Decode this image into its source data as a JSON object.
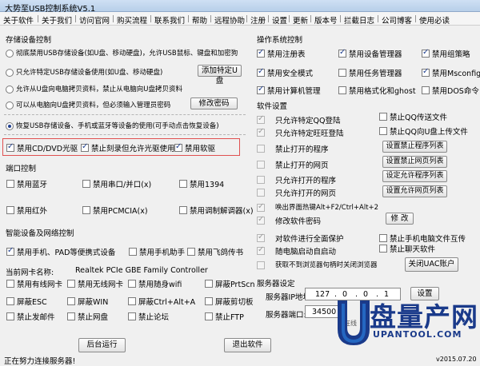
{
  "window": {
    "title": "大势至USB控制系统V5.1"
  },
  "menu": [
    "关于软件",
    "关于我们",
    "访问官网",
    "购买流程",
    "联系我们",
    "帮助",
    "远程协助",
    "注册",
    "设置",
    "更新",
    "版本号",
    "拦截日志",
    "公司博客",
    "使用必读"
  ],
  "storage": {
    "heading": "存储设备控制",
    "options": [
      "彻底禁用USB存储设备(如U盘、移动硬盘)，允许USB鼠标、键盘和加密狗",
      "只允许特定USB存储设备使用(如U盘、移动硬盘)",
      "允许从U盘向电脑拷贝资料，禁止从电脑向U盘拷贝资料",
      "可以从电脑向U盘拷贝资料，但必须输入管理员密码",
      "恢复USB存储设备、手机或蓝牙等设备的使用(可手动点击恢复设备)"
    ],
    "add_usb_button": "添加特定U盘",
    "change_pwd_button": "修改密码"
  },
  "cd": {
    "items": [
      "禁用CD/DVD光驱",
      "禁止刻录但允许光驱使用",
      "禁用软驱"
    ]
  },
  "port": {
    "heading": "端口控制",
    "items": [
      "禁用蓝牙",
      "禁用串口/并口(x)",
      "禁用1394",
      "禁用红外",
      "禁用PCMCIA(x)",
      "禁用调制解调器(x)"
    ]
  },
  "smart": {
    "heading": "智能设备及网络控制",
    "items": [
      "禁用手机、PAD等便携式设备",
      "禁用手机助手",
      "禁用飞鸽传书"
    ]
  },
  "nic": {
    "label": "当前网卡名称:",
    "name": "Realtek PCIe GBE Family Controller",
    "items": [
      "禁用有线网卡",
      "禁用无线网卡",
      "禁用随身wifi",
      "屏蔽PrtScn",
      "屏蔽ESC",
      "屏蔽WIN",
      "屏蔽Ctrl+Alt+A",
      "屏蔽剪切板",
      "禁止发邮件",
      "禁止网盘",
      "禁止论坛",
      "禁止FTP"
    ]
  },
  "os": {
    "heading": "操作系统控制",
    "items": [
      "禁用注册表",
      "禁用设备管理器",
      "禁用组策略",
      "禁用安全模式",
      "禁用任务管理器",
      "禁用Msconfig",
      "禁用计算机管理",
      "禁用格式化和ghost",
      "禁用DOS命令"
    ]
  },
  "software": {
    "heading": "软件设置",
    "items": [
      "只允许特定QQ登陆",
      "禁止QQ传送文件",
      "只允许特定旺旺登陆",
      "禁止QQ向U盘上传文件",
      "禁止打开的程序",
      "禁止打开的网页",
      "只允许打开的程序",
      "只允许打开的网页",
      "唤出界面热键Alt+F2/Ctrl+Alt+2",
      "修改软件密码",
      "对软件进行全面保护",
      "禁止手机电脑文件互传",
      "随电脑启动自启动",
      "禁止聊天软件",
      "获取不到浏览器句柄时关闭浏览器"
    ],
    "buttons": [
      "设置禁止程序列表",
      "设置禁止网页列表",
      "设定允许程序列表",
      "设置允许网页列表"
    ],
    "modify_button": "修 改",
    "uac_button": "关闭UAC账户"
  },
  "server": {
    "heading": "服务器设定",
    "ip_label": "服务器IP地址:",
    "ip": [
      "127",
      "0",
      "0",
      "1"
    ],
    "port_label": "服务器端口:",
    "port": "34500",
    "set_button": "设置",
    "partial": "在线"
  },
  "buttons": {
    "run_background": "后台运行",
    "exit": "退出软件"
  },
  "status": "正在努力连接服务器!",
  "version": "v2015.07.20",
  "watermark": {
    "brand": "盘量产网",
    "url": "UPANTOOL.COM"
  },
  "colors": {
    "accent": "#1f3f8f",
    "highlight": "#e05050",
    "logo": "#1a3a8a"
  }
}
